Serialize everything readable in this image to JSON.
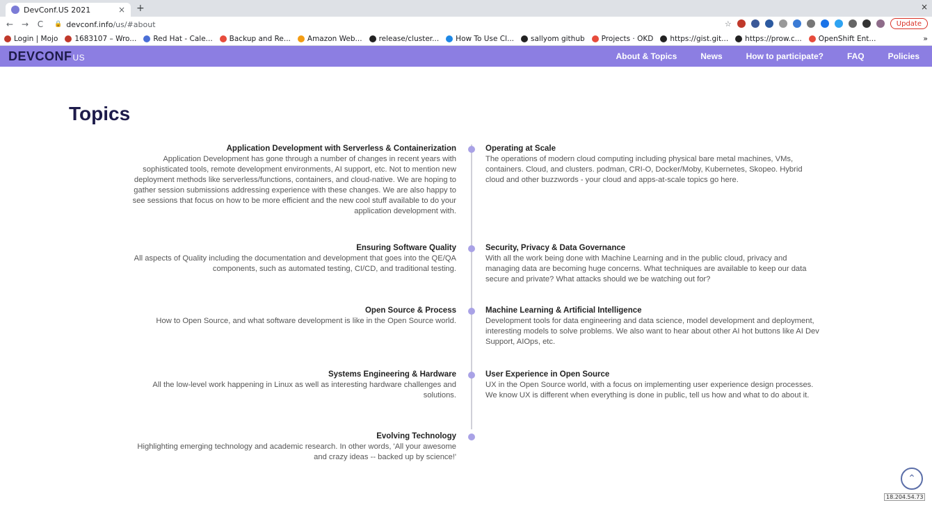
{
  "browser": {
    "tab_title": "DevConf.US 2021",
    "tab_close": "×",
    "new_tab": "+",
    "window_close": "×",
    "url_host": "devconf.info",
    "url_path": "/us/#about",
    "update_label": "Update",
    "bookmarks": [
      {
        "label": "Login | Mojo",
        "color": "#c0392b"
      },
      {
        "label": "1683107 – Wro...",
        "color": "#c0392b"
      },
      {
        "label": "Red Hat - Cale...",
        "color": "#4a6fd6"
      },
      {
        "label": "Backup and Re...",
        "color": "#e74c3c"
      },
      {
        "label": "Amazon Web...",
        "color": "#f39c12"
      },
      {
        "label": "release/cluster...",
        "color": "#222222"
      },
      {
        "label": "How To Use Cl...",
        "color": "#1e88e5"
      },
      {
        "label": "sallyom github",
        "color": "#222222"
      },
      {
        "label": "Projects · OKD",
        "color": "#e74c3c"
      },
      {
        "label": "https://gist.git...",
        "color": "#222222"
      },
      {
        "label": "https://prow.c...",
        "color": "#222222"
      },
      {
        "label": "OpenShift Ent...",
        "color": "#e74c3c"
      }
    ],
    "bookmarks_more": "»"
  },
  "site": {
    "logo_main": "DEVCONF",
    "logo_suffix": "US",
    "nav": [
      "About & Topics",
      "News",
      "How to participate?",
      "FAQ",
      "Policies"
    ],
    "heading": "Topics",
    "accent_color": "#8c7ee2"
  },
  "topics_left": [
    {
      "title": "Application Development with Serverless & Containerization",
      "desc": "Application Development has gone through a number of changes in recent years with sophisticated tools, remote development environments, AI support, etc. Not to mention new deployment methods like serverless/functions, containers, and cloud-native. We are hoping to gather session submissions addressing experience with these changes. We are also happy to see sessions that focus on how to be more efficient and the new cool stuff available to do your application development with."
    },
    {
      "title": "Ensuring Software Quality",
      "desc": "All aspects of Quality including the documentation and development that goes into the QE/QA components, such as automated testing, CI/CD, and traditional testing."
    },
    {
      "title": "Open Source & Process",
      "desc": "How to Open Source, and what software development is like in the Open Source world."
    },
    {
      "title": "Systems Engineering & Hardware",
      "desc": "All the low-level work happening in Linux as well as interesting hardware challenges and solutions."
    },
    {
      "title": "Evolving Technology",
      "desc": "Highlighting emerging technology and academic research. In other words, 'All your awesome and crazy ideas -- backed up by science!'"
    }
  ],
  "topics_right": [
    {
      "title": "Operating at Scale",
      "desc": "The operations of modern cloud computing including physical bare metal machines, VMs, containers. Cloud, and clusters. podman, CRI-O, Docker/Moby, Kubernetes, Skopeo. Hybrid cloud and other buzzwords - your cloud and apps-at-scale topics go here."
    },
    {
      "title": "Security, Privacy & Data Governance",
      "desc": "With all the work being done with Machine Learning and in the public cloud, privacy and managing data are becoming huge concerns. What techniques are available to keep our data secure and private? What attacks should we be watching out for?"
    },
    {
      "title": "Machine Learning & Artificial Intelligence",
      "desc": "Development tools for data engineering and data science, model development and deployment, interesting models to solve problems. We also want to hear about other AI hot buttons like AI Dev Support, AIOps, etc."
    },
    {
      "title": "User Experience in Open Source",
      "desc": "UX in the Open Source world, with a focus on implementing user experience design processes. We know UX is different when everything is done in public, tell us how and what to do about it."
    }
  ],
  "ip_badge": "18.204.54.73"
}
